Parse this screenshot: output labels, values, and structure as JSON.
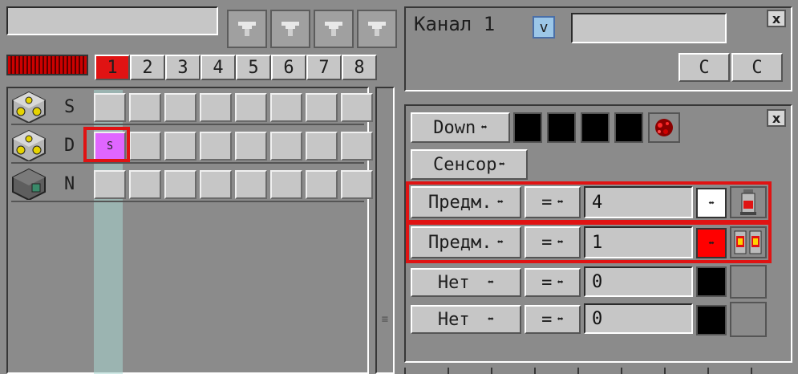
{
  "left": {
    "search": {
      "value": ""
    },
    "filter_icons": [
      "filter-icon",
      "filter-icon",
      "filter-icon",
      "filter-icon"
    ],
    "channel_tabs": [
      "1",
      "2",
      "3",
      "4",
      "5",
      "6",
      "7",
      "8"
    ],
    "active_tab": "1",
    "rows": [
      {
        "label": "S",
        "icon": "nuclear-reactor-icon",
        "slot_text": ""
      },
      {
        "label": "D",
        "icon": "nuclear-reactor-icon",
        "slot_text": "S"
      },
      {
        "label": "N",
        "icon": "machine-block-icon",
        "slot_text": ""
      }
    ]
  },
  "channel_panel": {
    "title": "Канал 1",
    "dropdown_glyph": "v",
    "name_value": "",
    "button_c1": "C",
    "button_c2": "C",
    "close": "x"
  },
  "sensor_panel": {
    "close": "x",
    "direction_label": "Down",
    "arrow_glyph": "⬌",
    "sensor_label": "Сенсор",
    "conditions": [
      {
        "type": "Предм.",
        "op": "=",
        "value": "4",
        "color": "#ffffff",
        "item": "item-canister-icon"
      },
      {
        "type": "Предм.",
        "op": "=",
        "value": "1",
        "color": "#ff0000",
        "item": "item-redstone-lamps-icon"
      },
      {
        "type": "Нет",
        "op": "=",
        "value": "0",
        "color": "#000000",
        "item": ""
      },
      {
        "type": "Нет",
        "op": "=",
        "value": "0",
        "color": "#000000",
        "item": ""
      }
    ]
  },
  "colors": {
    "accent_red": "#e01313",
    "highlight_magenta": "#e066ff",
    "bar_red": "#cc0000"
  }
}
